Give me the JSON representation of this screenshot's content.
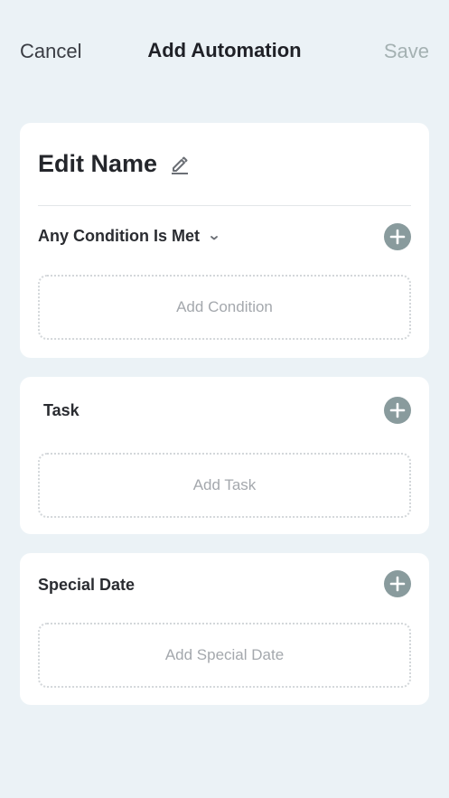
{
  "header": {
    "cancel_label": "Cancel",
    "title": "Add Automation",
    "save_label": "Save"
  },
  "automation": {
    "name_label": "Edit Name",
    "condition_mode": "Any Condition Is Met",
    "add_condition_label": "Add Condition"
  },
  "task": {
    "label": "Task",
    "add_task_label": "Add Task"
  },
  "special_date": {
    "label": "Special Date",
    "add_special_date_label": "Add Special Date"
  },
  "colors": {
    "background": "#ebf2f6",
    "card": "#ffffff",
    "plus_button": "#899b9d",
    "save_disabled": "#a4b1b2"
  },
  "icons": {
    "edit": "pencil-icon",
    "condition_dropdown": "chevron-down-icon",
    "add": "plus-icon"
  }
}
